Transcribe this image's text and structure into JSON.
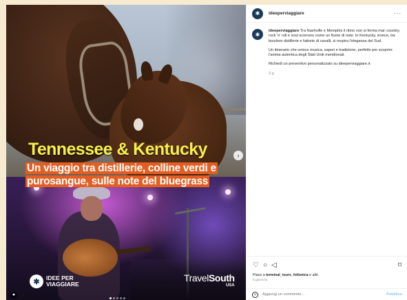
{
  "post": {
    "title": "Tennessee & Kentucky",
    "subtitle": "Un viaggio tra distillerie, colline verdi e purosangue, sulle note del bluegrass",
    "brand_left": "IDEE PER VIAGGIARE",
    "brand_right_travel": "Travel",
    "brand_right_south": "South",
    "brand_right_usa": "USA"
  },
  "panel": {
    "username": "ideeperviaggiare",
    "caption_user": "ideeperviaggiare",
    "caption_p1": "Tra Nashville e Memphis il ritmo non si ferma mai: country, rock 'n' roll e soul scorrono come un fiume di note. In Kentucky, invece, tra bourbon distillerie e fattorie di cavalli, si respira l'eleganza del Sud.",
    "caption_p2": "Un itinerario che unisce musica, sapori e tradizione, perfetto per scoprire l'anima autentica degli Stati Uniti meridionali.",
    "caption_p3": "Richiedi un preventivo personalizzato su ideeperviaggiare.it",
    "caption_time": "3 g",
    "likes_prefix": "Piace a",
    "likes_user": "terminal_tours_follonica",
    "likes_suffix": "e altri",
    "days_ago": "5 giorni fa",
    "comment_placeholder": "Aggiungi un commento...",
    "publish_label": "Pubblica"
  },
  "icons": {
    "like": "heart-icon",
    "comment": "comment-icon",
    "share": "send-icon",
    "save": "bookmark-icon",
    "more": "more-icon",
    "next": "chevron-right-icon",
    "emoji": "emoji-icon",
    "user_tag": "user-tag-icon"
  },
  "colors": {
    "title_yellow": "#f7f04a",
    "subtitle_orange": "#e35e22",
    "publish_blue": "#8ec5fb",
    "avatar_navy": "#1b3a57"
  }
}
